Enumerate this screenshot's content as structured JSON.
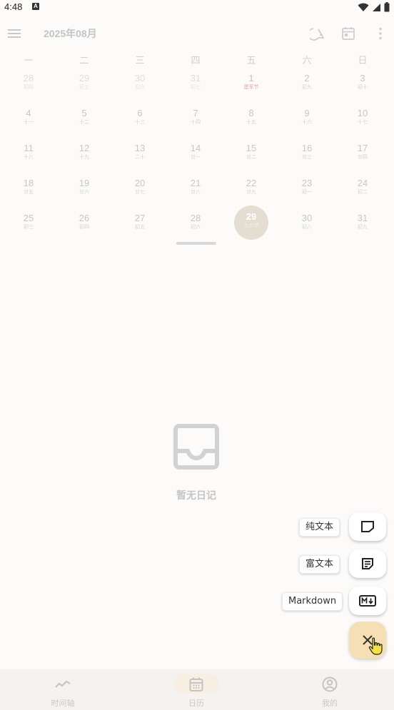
{
  "status_bar": {
    "time": "4:48",
    "notification_letter": "A"
  },
  "toolbar": {
    "title": "2025年08月"
  },
  "weekdays": [
    "一",
    "二",
    "三",
    "四",
    "五",
    "六",
    "日"
  ],
  "calendar": {
    "weeks": [
      [
        {
          "num": "28",
          "sub": "初四",
          "type": "other"
        },
        {
          "num": "29",
          "sub": "初五",
          "type": "other"
        },
        {
          "num": "30",
          "sub": "初六",
          "type": "other"
        },
        {
          "num": "31",
          "sub": "初七",
          "type": "other"
        },
        {
          "num": "1",
          "sub": "建军节",
          "type": "holiday"
        },
        {
          "num": "2",
          "sub": "初九",
          "type": "normal"
        },
        {
          "num": "3",
          "sub": "初十",
          "type": "normal"
        }
      ],
      [
        {
          "num": "4",
          "sub": "十一",
          "type": "normal"
        },
        {
          "num": "5",
          "sub": "十二",
          "type": "normal"
        },
        {
          "num": "6",
          "sub": "十三",
          "type": "normal"
        },
        {
          "num": "7",
          "sub": "十四",
          "type": "normal"
        },
        {
          "num": "8",
          "sub": "十五",
          "type": "normal"
        },
        {
          "num": "9",
          "sub": "十六",
          "type": "normal"
        },
        {
          "num": "10",
          "sub": "十七",
          "type": "normal"
        }
      ],
      [
        {
          "num": "11",
          "sub": "十八",
          "type": "normal"
        },
        {
          "num": "12",
          "sub": "十九",
          "type": "normal"
        },
        {
          "num": "13",
          "sub": "二十",
          "type": "normal"
        },
        {
          "num": "14",
          "sub": "廿一",
          "type": "normal"
        },
        {
          "num": "15",
          "sub": "廿二",
          "type": "normal"
        },
        {
          "num": "16",
          "sub": "廿三",
          "type": "normal"
        },
        {
          "num": "17",
          "sub": "廿四",
          "type": "normal"
        }
      ],
      [
        {
          "num": "18",
          "sub": "廿五",
          "type": "normal"
        },
        {
          "num": "19",
          "sub": "廿六",
          "type": "normal"
        },
        {
          "num": "20",
          "sub": "廿七",
          "type": "normal"
        },
        {
          "num": "21",
          "sub": "廿八",
          "type": "normal"
        },
        {
          "num": "22",
          "sub": "廿九",
          "type": "normal"
        },
        {
          "num": "23",
          "sub": "初一",
          "type": "normal"
        },
        {
          "num": "24",
          "sub": "初二",
          "type": "normal"
        }
      ],
      [
        {
          "num": "25",
          "sub": "初三",
          "type": "normal"
        },
        {
          "num": "26",
          "sub": "初四",
          "type": "normal"
        },
        {
          "num": "27",
          "sub": "初五",
          "type": "normal"
        },
        {
          "num": "28",
          "sub": "初六",
          "type": "normal"
        },
        {
          "num": "29",
          "sub": "七夕节",
          "type": "today"
        },
        {
          "num": "30",
          "sub": "初八",
          "type": "normal"
        },
        {
          "num": "31",
          "sub": "初九",
          "type": "normal"
        }
      ]
    ]
  },
  "empty_state": {
    "text": "暂无日记"
  },
  "fab_menu": {
    "plain_text_label": "纯文本",
    "rich_text_label": "富文本",
    "markdown_label": "Markdown"
  },
  "bottom_nav": {
    "items": [
      {
        "label": "时间轴",
        "icon": "timeline-icon",
        "active": false
      },
      {
        "label": "日历",
        "icon": "calendar-icon",
        "active": true
      },
      {
        "label": "我的",
        "icon": "profile-icon",
        "active": false
      }
    ]
  },
  "colors": {
    "background": "#fcfbfa",
    "today_circle": "#e4ddd1",
    "fab_primary": "#f6dfb4",
    "holiday_text": "#e9a5a5"
  }
}
